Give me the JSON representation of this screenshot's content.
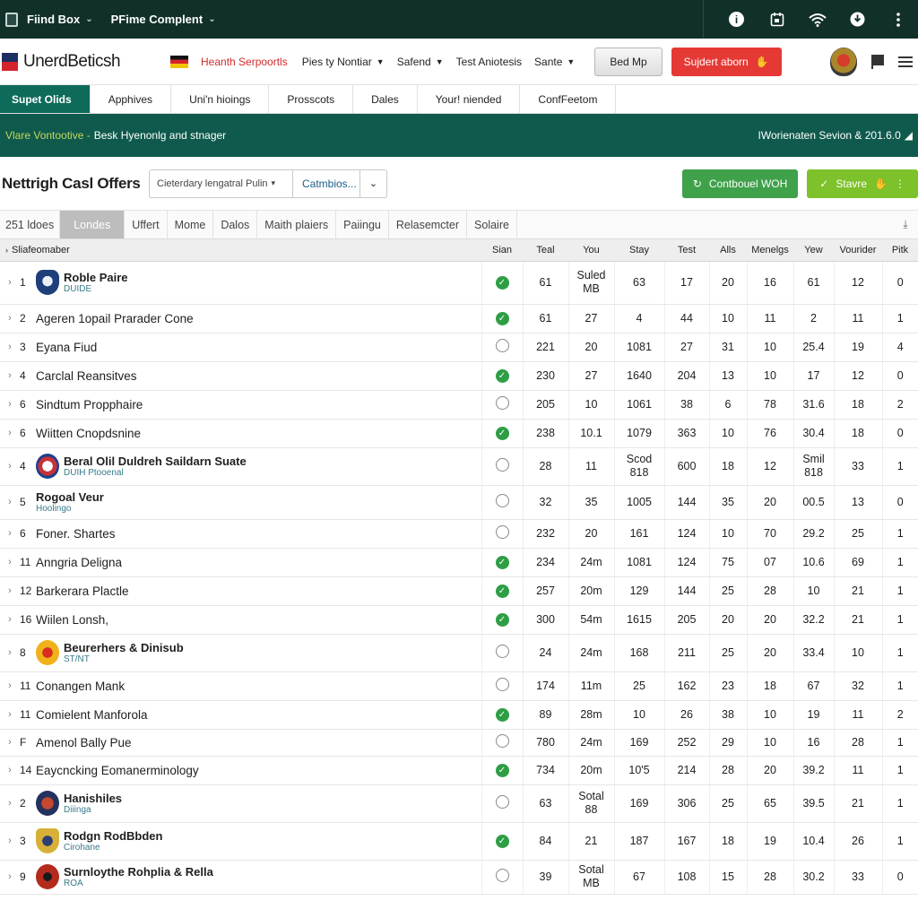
{
  "topbar": {
    "find_box": "Fiind Box",
    "prime_complent": "PFime Complent"
  },
  "header": {
    "brand": "UnerdBeticsh",
    "red_link": "Heanth Serpoortls",
    "menus": [
      "Pies ty Nontiar",
      "Safend",
      "Test Aniotesis",
      "Sante"
    ],
    "grey_button": "Bed Mp",
    "red_button": "Sujdert aborn"
  },
  "navtabs": [
    "Supet Olids",
    "Apphives",
    "Uni'n hioings",
    "Prosscots",
    "Dales",
    "Your! niended",
    "ConfFeetom"
  ],
  "banner": {
    "highlight": "Vlare Vontootive -",
    "text": "Besk Hyenonlg and stnager",
    "right": "IWorienaten Sevion & 201.6.0"
  },
  "titlerow": {
    "title": "Nettrigh Casl Offers",
    "search_placeholder": "Cieterdary lengatral Pulin",
    "filter": "Catmbios...",
    "green_button": "Contbouel WOH",
    "lime_button": "Stavre"
  },
  "filter_tabs": [
    "251 ldoes",
    "Londes",
    "Uffert",
    "Mome",
    "Dalos",
    "Maith plaiers",
    "Paiingu",
    "Relasemcter",
    "Solaire"
  ],
  "table": {
    "headers": [
      "Sliafeomaber",
      "Sian",
      "Teal",
      "You",
      "Stay",
      "Test",
      "Alls",
      "Menelgs",
      "Yew",
      "Vourider",
      "Pitk"
    ],
    "rows": [
      {
        "num": "1",
        "name": "Roble Paire",
        "sub": "DUIDE",
        "logo": "shield-blue",
        "status": "ok",
        "teal": "61",
        "you": "Suled MB",
        "stay": "63",
        "test": "17",
        "alls": "20",
        "menelgs": "16",
        "yew": "61",
        "vourider": "12",
        "pitk": "0"
      },
      {
        "num": "2",
        "name": "Ageren 1opail Prarader Cone",
        "sub": "",
        "logo": "",
        "status": "ok",
        "teal": "61",
        "you": "27",
        "stay": "4",
        "test": "44",
        "alls": "10",
        "menelgs": "11",
        "yew": "2",
        "vourider": "11",
        "pitk": "1"
      },
      {
        "num": "3",
        "name": "Eyana Fiud",
        "sub": "",
        "logo": "",
        "status": "no",
        "teal": "221",
        "you": "20",
        "stay": "1081",
        "test": "27",
        "alls": "31",
        "menelgs": "10",
        "yew": "25.4",
        "vourider": "19",
        "pitk": "4"
      },
      {
        "num": "4",
        "name": "Carclal Reansitves",
        "sub": "",
        "logo": "",
        "status": "ok",
        "teal": "230",
        "you": "27",
        "stay": "1640",
        "test": "204",
        "alls": "13",
        "menelgs": "10",
        "yew": "17",
        "vourider": "12",
        "pitk": "0"
      },
      {
        "num": "6",
        "name": "Sindtum Propphaire",
        "sub": "",
        "logo": "",
        "status": "no",
        "teal": "205",
        "you": "10",
        "stay": "1061",
        "test": "38",
        "alls": "6",
        "menelgs": "78",
        "yew": "31.6",
        "vourider": "18",
        "pitk": "2"
      },
      {
        "num": "6",
        "name": "Wiitten Cnopdsnine",
        "sub": "",
        "logo": "",
        "status": "ok",
        "teal": "238",
        "you": "10.1",
        "stay": "1079",
        "test": "363",
        "alls": "10",
        "menelgs": "76",
        "yew": "30.4",
        "vourider": "18",
        "pitk": "0"
      },
      {
        "num": "4",
        "name": "Beral Olil Duldreh Saildarn Suate",
        "sub": "DUIH Ptooenal",
        "logo": "round-flag",
        "status": "no",
        "teal": "28",
        "you": "11",
        "stay": "Scod 818",
        "test": "600",
        "alls": "18",
        "menelgs": "12",
        "yew": "Smil 818",
        "vourider": "33",
        "pitk": "1"
      },
      {
        "num": "5",
        "name": "Rogoal Veur",
        "sub": "Hoolingo",
        "logo": "",
        "status": "no",
        "teal": "32",
        "you": "35",
        "stay": "1005",
        "test": "144",
        "alls": "35",
        "menelgs": "20",
        "yew": "00.5",
        "vourider": "13",
        "pitk": "0"
      },
      {
        "num": "6",
        "name": "Foner. Shartes",
        "sub": "",
        "logo": "",
        "status": "no",
        "teal": "232",
        "you": "20",
        "stay": "161",
        "test": "124",
        "alls": "10",
        "menelgs": "70",
        "yew": "29.2",
        "vourider": "25",
        "pitk": "1"
      },
      {
        "num": "11",
        "name": "Anngria Deligna",
        "sub": "",
        "logo": "",
        "status": "ok",
        "teal": "234",
        "you": "24m",
        "stay": "1081",
        "test": "124",
        "alls": "75",
        "menelgs": "07",
        "yew": "10.6",
        "vourider": "69",
        "pitk": "1"
      },
      {
        "num": "12",
        "name": "Barkerara Plactle",
        "sub": "",
        "logo": "",
        "status": "ok",
        "teal": "257",
        "you": "20m",
        "stay": "129",
        "test": "144",
        "alls": "25",
        "menelgs": "28",
        "yew": "10",
        "vourider": "21",
        "pitk": "1"
      },
      {
        "num": "16",
        "name": "Wiilen Lonsh,",
        "sub": "",
        "logo": "",
        "status": "ok",
        "teal": "300",
        "you": "54m",
        "stay": "1615",
        "test": "205",
        "alls": "20",
        "menelgs": "20",
        "yew": "32.2",
        "vourider": "21",
        "pitk": "1"
      },
      {
        "num": "8",
        "name": "Beurerhers & Dinisub",
        "sub": "ST/NT",
        "logo": "crest-yellow",
        "status": "no",
        "teal": "24",
        "you": "24m",
        "stay": "168",
        "test": "211",
        "alls": "25",
        "menelgs": "20",
        "yew": "33.4",
        "vourider": "10",
        "pitk": "1"
      },
      {
        "num": "11",
        "name": "Conangen Mank",
        "sub": "",
        "logo": "",
        "status": "no",
        "teal": "174",
        "you": "11m",
        "stay": "25",
        "test": "162",
        "alls": "23",
        "menelgs": "18",
        "yew": "67",
        "vourider": "32",
        "pitk": "1"
      },
      {
        "num": "11",
        "name": "Comielent Manforola",
        "sub": "",
        "logo": "",
        "status": "ok",
        "teal": "89",
        "you": "28m",
        "stay": "10",
        "test": "26",
        "alls": "38",
        "menelgs": "10",
        "yew": "19",
        "vourider": "11",
        "pitk": "2"
      },
      {
        "num": "F",
        "name": "Amenol Bally Pue",
        "sub": "",
        "logo": "",
        "status": "no",
        "teal": "780",
        "you": "24m",
        "stay": "169",
        "test": "252",
        "alls": "29",
        "menelgs": "10",
        "yew": "16",
        "vourider": "28",
        "pitk": "1"
      },
      {
        "num": "14",
        "name": "Eaycncking Eomanerminology",
        "sub": "",
        "logo": "",
        "status": "ok",
        "teal": "734",
        "you": "20m",
        "stay": "10'5",
        "test": "214",
        "alls": "28",
        "menelgs": "20",
        "yew": "39.2",
        "vourider": "11",
        "pitk": "1"
      },
      {
        "num": "2",
        "name": "Hanishiles",
        "sub": "Diiinga",
        "logo": "round-dark",
        "status": "no",
        "teal": "63",
        "you": "Sotal 88",
        "stay": "169",
        "test": "306",
        "alls": "25",
        "menelgs": "65",
        "yew": "39.5",
        "vourider": "21",
        "pitk": "1"
      },
      {
        "num": "3",
        "name": "Rodgn RodBbden",
        "sub": "Cirohane",
        "logo": "crest-shield",
        "status": "ok",
        "teal": "84",
        "you": "21",
        "stay": "187",
        "test": "167",
        "alls": "18",
        "menelgs": "19",
        "yew": "10.4",
        "vourider": "26",
        "pitk": "1"
      },
      {
        "num": "9",
        "name": "Surnloythe Rohplia & Rella",
        "sub": "ROA",
        "logo": "crest-red",
        "status": "no",
        "teal": "39",
        "you": "Sotal MB",
        "stay": "67",
        "test": "108",
        "alls": "15",
        "menelgs": "28",
        "yew": "30.2",
        "vourider": "33",
        "pitk": "0"
      }
    ]
  }
}
